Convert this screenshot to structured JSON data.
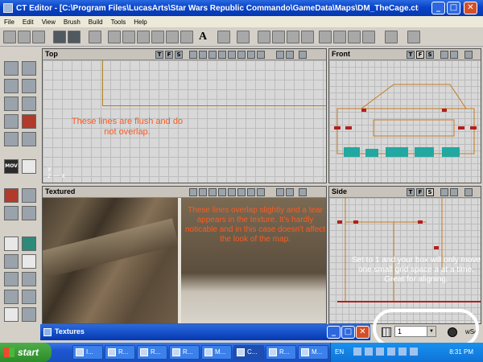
{
  "window": {
    "title": "CT Editor - [C:\\Program Files\\LucasArts\\Star Wars Republic Commando\\GameData\\Maps\\DM_TheCage.ctm]",
    "minimize": "_",
    "maximize": "□",
    "close": "✕"
  },
  "menu": [
    "File",
    "Edit",
    "View",
    "Brush",
    "Build",
    "Tools",
    "Help"
  ],
  "toolbar": {
    "font_button": "A"
  },
  "viewports": {
    "top": {
      "label": "Top",
      "btn_t": "T",
      "btn_f": "F",
      "btn_s": "S"
    },
    "front": {
      "label": "Front",
      "btn_t": "T",
      "btn_f": "F",
      "btn_s": "S"
    },
    "textured": {
      "label": "Textured"
    },
    "side": {
      "label": "Side",
      "btn_t": "T",
      "btn_f": "F",
      "btn_s": "S"
    }
  },
  "notes": {
    "top": "These lines are flush and do not overlap.",
    "textured": "These lines overlap slightly and a tear appears in the texture. It's hardly noticable and in this case doesn't affect the look of the map.",
    "side": "Set to 1 and your box will only move one small grid space a at a time. Great for aligning."
  },
  "left_tools": {
    "mov_label": "MOV"
  },
  "textures_window": {
    "title": "Textures"
  },
  "grid_size": {
    "value": "1",
    "arrow": "▼",
    "trailing_text": "wSc"
  },
  "taskbar": {
    "start": "start",
    "tasks": [
      "I...",
      "R...",
      "R...",
      "R...",
      "M...",
      "C...",
      "R...",
      "M..."
    ],
    "language": "EN",
    "clock": "8:31 PM"
  }
}
